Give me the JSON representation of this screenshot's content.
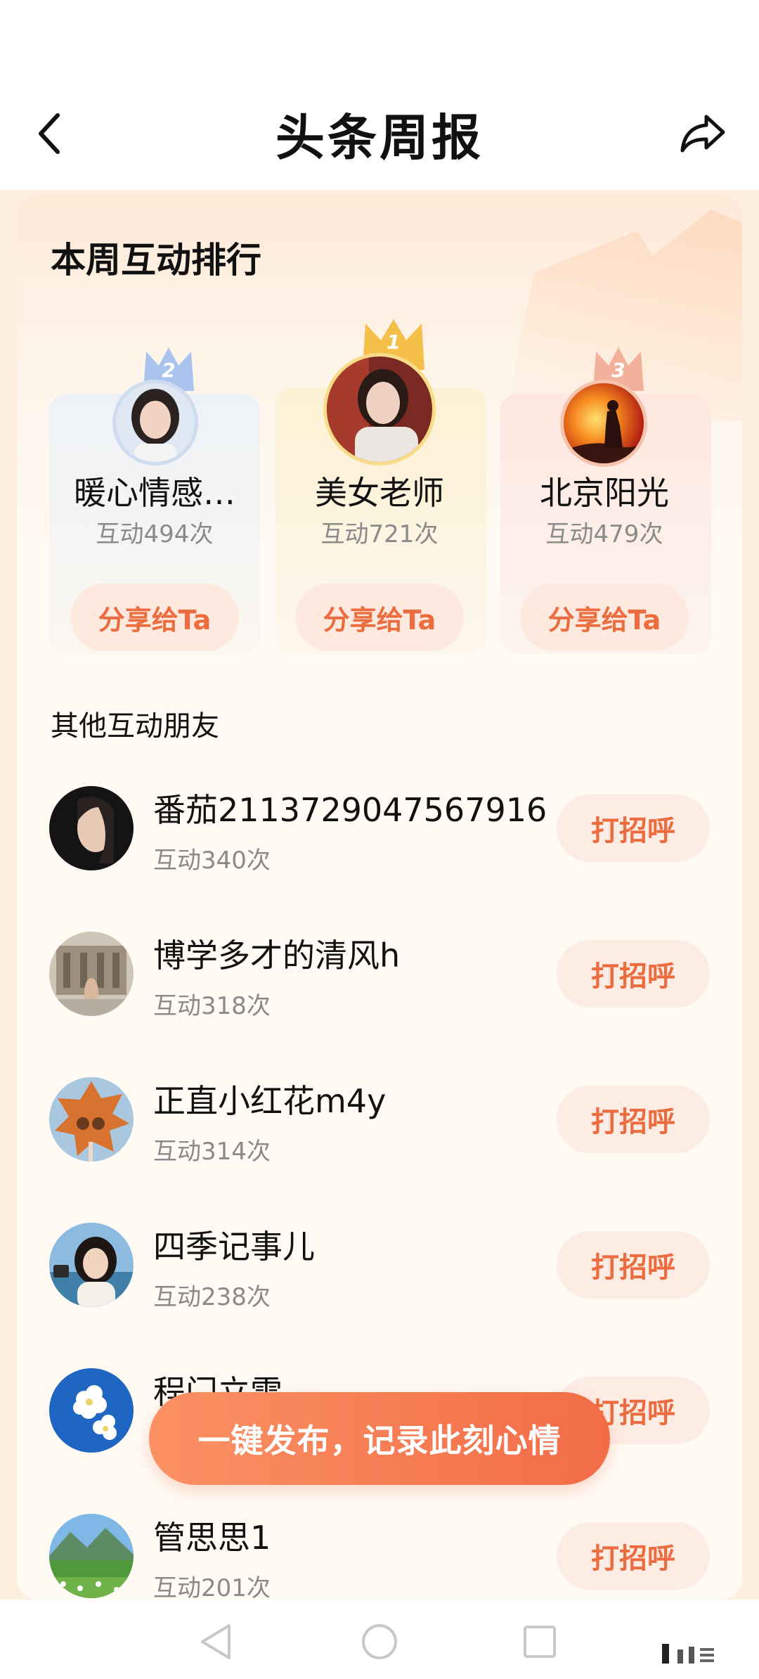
{
  "header": {
    "title": "头条周报"
  },
  "weekly_ranking": {
    "title": "本周互动排行",
    "podium": [
      {
        "rank": "2",
        "name": "暖心情感…",
        "count": "互动494次",
        "button": "分享给Ta"
      },
      {
        "rank": "1",
        "name": "美女老师",
        "count": "互动721次",
        "button": "分享给Ta"
      },
      {
        "rank": "3",
        "name": "北京阳光",
        "count": "互动479次",
        "button": "分享给Ta"
      }
    ]
  },
  "other_friends": {
    "title": "其他互动朋友",
    "items": [
      {
        "name": "番茄2113729047567916",
        "count": "互动340次",
        "button": "打招呼"
      },
      {
        "name": "博学多才的清风h",
        "count": "互动318次",
        "button": "打招呼"
      },
      {
        "name": "正直小红花m4y",
        "count": "互动314次",
        "button": "打招呼"
      },
      {
        "name": "四季记事儿",
        "count": "互动238次",
        "button": "打招呼"
      },
      {
        "name": "程门立雪",
        "count": "",
        "button": "打招呼"
      },
      {
        "name": "管思思1",
        "count": "互动201次",
        "button": "打招呼"
      }
    ]
  },
  "publish_button": "一键发布，记录此刻心情",
  "colors": {
    "accent": "#ec6b3f",
    "gold": "#f5c04a",
    "silver": "#a9c4ec",
    "bronze": "#f3b09a"
  }
}
